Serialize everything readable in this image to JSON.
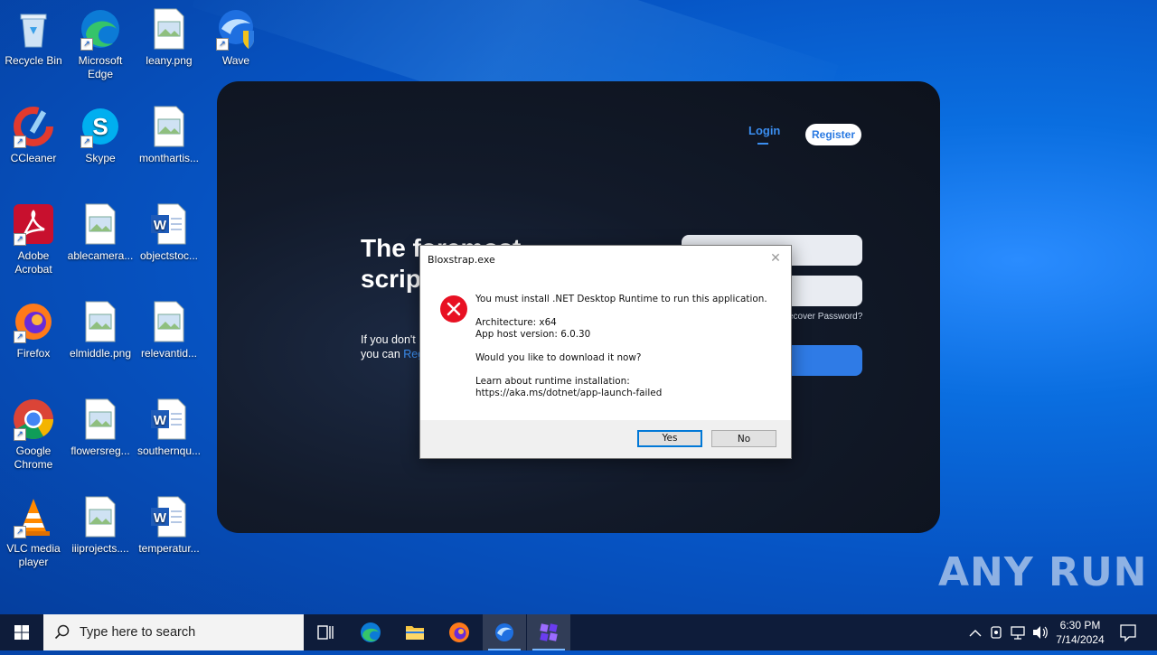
{
  "desktop": {
    "icons": [
      {
        "label": "Recycle Bin"
      },
      {
        "label": "Microsoft Edge"
      },
      {
        "label": "leany.png"
      },
      {
        "label": "Wave"
      },
      {
        "label": "CCleaner"
      },
      {
        "label": "Skype"
      },
      {
        "label": "monthartis..."
      },
      {
        "label": "Adobe Acrobat"
      },
      {
        "label": "ablecamera..."
      },
      {
        "label": "objectstoc..."
      },
      {
        "label": "Firefox"
      },
      {
        "label": "elmiddle.png"
      },
      {
        "label": "relevantid..."
      },
      {
        "label": "Google Chrome"
      },
      {
        "label": "flowersreg..."
      },
      {
        "label": "southernqu..."
      },
      {
        "label": "VLC media player"
      },
      {
        "label": "iiiprojects...."
      },
      {
        "label": "temperatur..."
      }
    ]
  },
  "app": {
    "nav_login": "Login",
    "nav_register": "Register",
    "headline_line1": "The foremost",
    "headline_line2": "scrip",
    "subtext_line1": "If you don't",
    "subtext_line2_prefix": "you can ",
    "subtext_line2_link": "Reg",
    "recover": "ecover Password?"
  },
  "dialog": {
    "title": "Bloxstrap.exe",
    "message": "You must install .NET Desktop Runtime to run this application.",
    "architecture": "Architecture: x64",
    "host_version": "App host version: 6.0.30",
    "question": "Would you like to download it now?",
    "learn": "Learn about runtime installation:",
    "link": "https://aka.ms/dotnet/app-launch-failed",
    "yes": "Yes",
    "no": "No"
  },
  "watermark": "ANY RUN",
  "taskbar": {
    "search_placeholder": "Type here to search",
    "time": "6:30 PM",
    "date": "7/14/2024"
  }
}
